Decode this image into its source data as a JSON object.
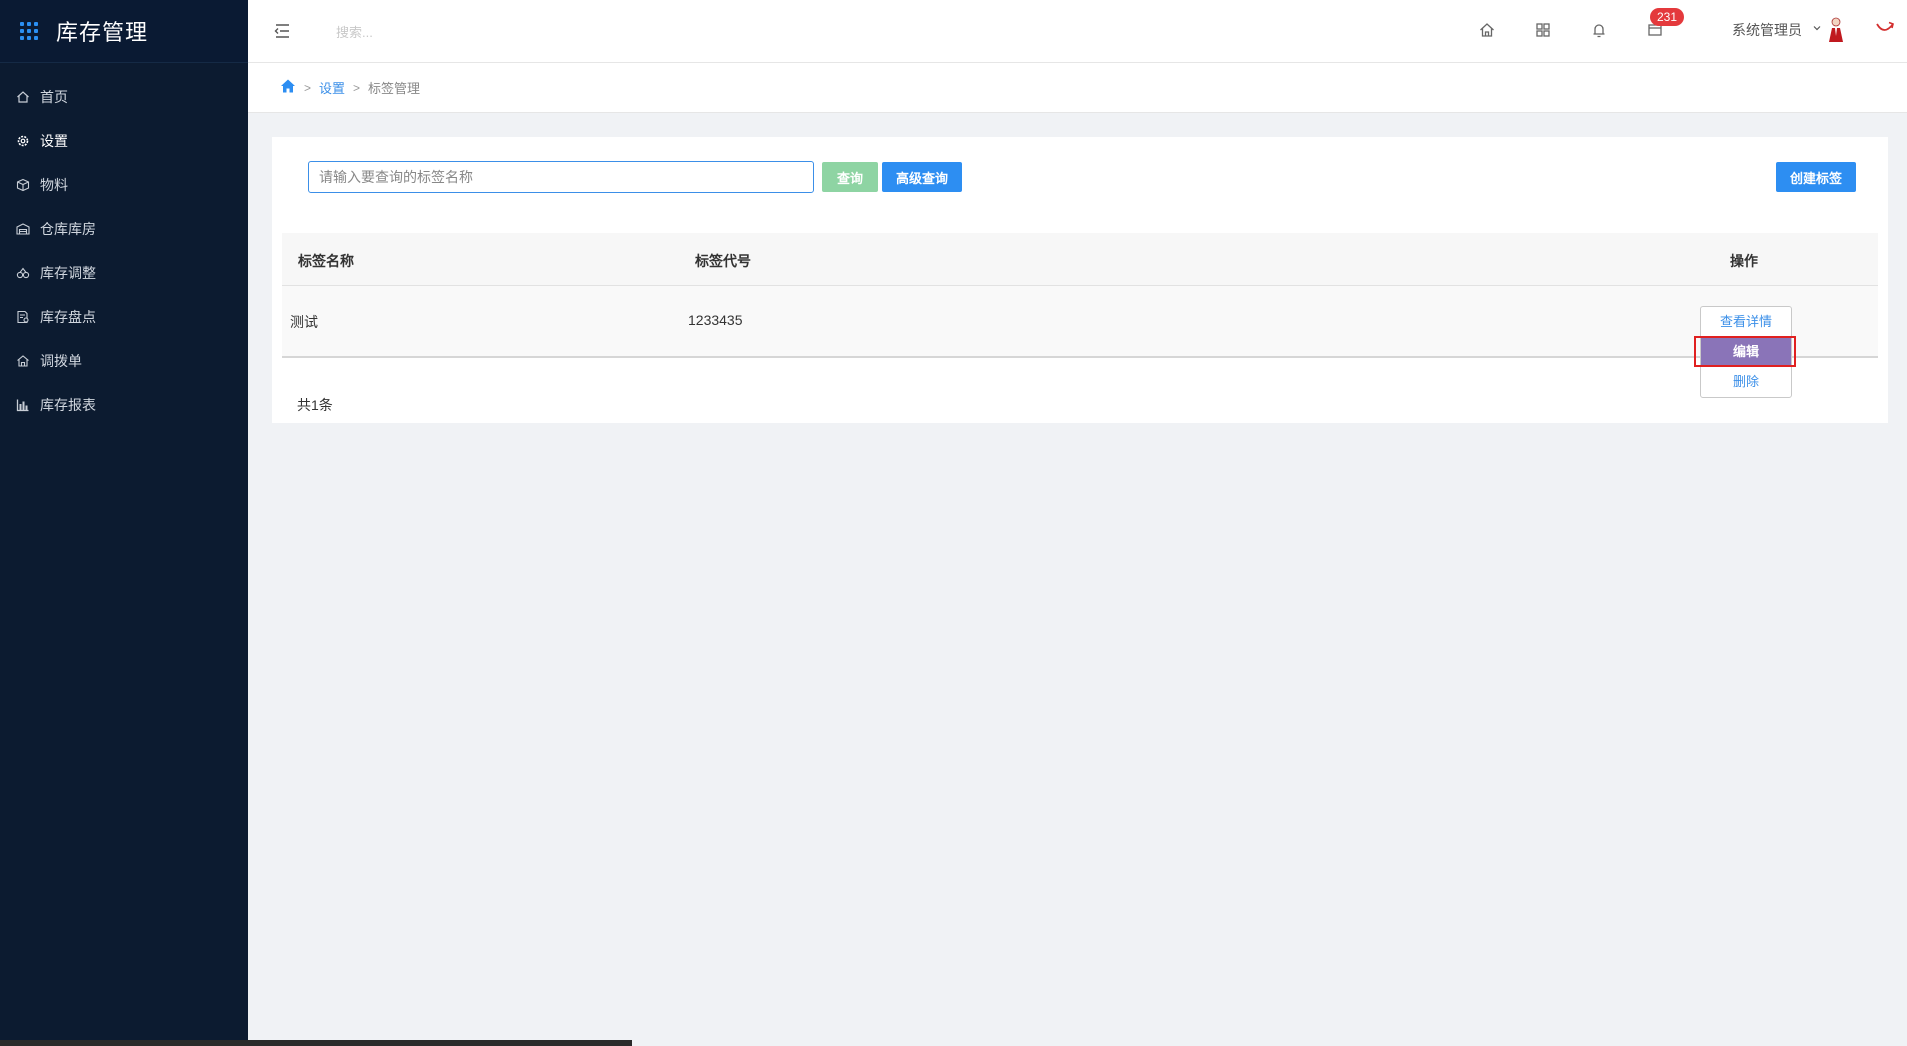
{
  "app": {
    "title": "库存管理",
    "accent": "#2d8ef2"
  },
  "sidebar": {
    "items": [
      {
        "label": "首页",
        "icon": "home-icon",
        "active": false
      },
      {
        "label": "设置",
        "icon": "gear-icon",
        "active": true
      },
      {
        "label": "物料",
        "icon": "box-icon",
        "active": false
      },
      {
        "label": "仓库库房",
        "icon": "warehouse-icon",
        "active": false
      },
      {
        "label": "库存调整",
        "icon": "adjust-icon",
        "active": false
      },
      {
        "label": "库存盘点",
        "icon": "inventory-icon",
        "active": false
      },
      {
        "label": "调拨单",
        "icon": "transfer-icon",
        "active": false
      },
      {
        "label": "库存报表",
        "icon": "bar-chart-icon",
        "active": false
      }
    ]
  },
  "topbar": {
    "search_placeholder": "搜索...",
    "notification_count": "231",
    "user_name": "系统管理员",
    "badge_color": "#e4393c"
  },
  "breadcrumb": {
    "settings": "设置",
    "current": "标签管理",
    "separator": ">"
  },
  "query": {
    "placeholder": "请输入要查询的标签名称",
    "query_label": "查询",
    "advanced_label": "高级查询",
    "create_label": "创建标签"
  },
  "table": {
    "headers": {
      "name": "标签名称",
      "code": "标签代号",
      "ops": "操作"
    },
    "rows": [
      {
        "name": "测试",
        "code": "1233435"
      }
    ],
    "actions": {
      "view": "查看详情",
      "edit": "编辑",
      "delete": "删除"
    },
    "total": "共1条"
  }
}
